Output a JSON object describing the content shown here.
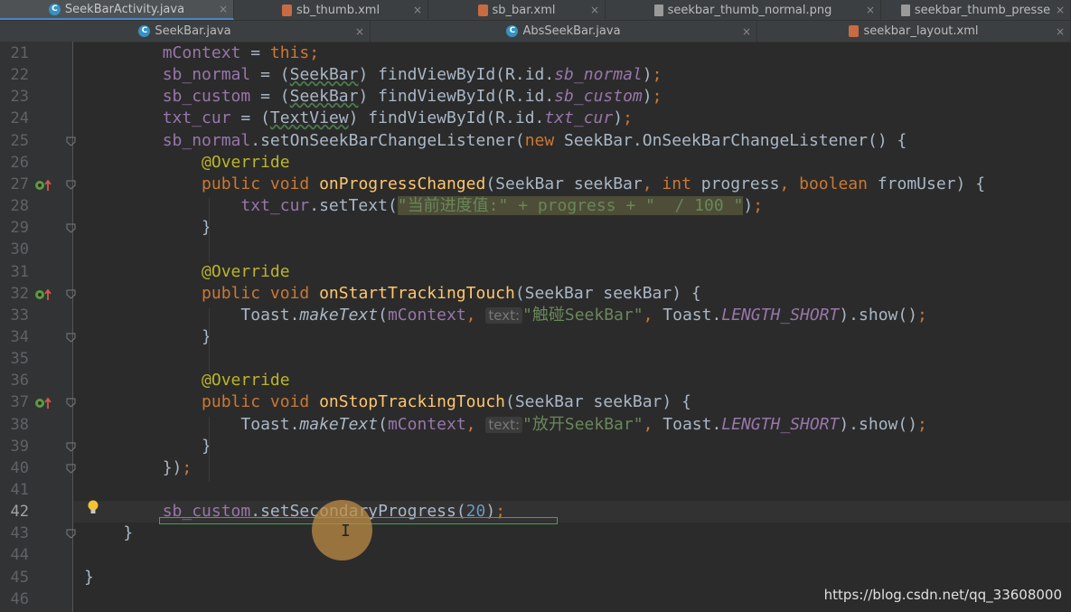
{
  "tabs_row1": [
    {
      "label": "SeekBarActivity.java",
      "icon": "java-class-icon",
      "active": true
    },
    {
      "label": "sb_thumb.xml",
      "icon": "xml-file-icon"
    },
    {
      "label": "sb_bar.xml",
      "icon": "xml-file-icon"
    },
    {
      "label": "seekbar_thumb_normal.png",
      "icon": "image-file-icon"
    },
    {
      "label": "seekbar_thumb_presse",
      "icon": "image-file-icon"
    }
  ],
  "tabs_row2": [
    {
      "label": "SeekBar.java",
      "icon": "java-class-icon"
    },
    {
      "label": "AbsSeekBar.java",
      "icon": "java-class-icon"
    },
    {
      "label": "seekbar_layout.xml",
      "icon": "xml-file-icon"
    }
  ],
  "close_glyph": "×",
  "lines": [
    {
      "n": "21",
      "t": [
        [
          "",
          "        "
        ],
        [
          "fld",
          "mContext"
        ],
        [
          "",
          " = "
        ],
        [
          "kw",
          "this"
        ],
        [
          "kw",
          ";"
        ]
      ]
    },
    {
      "n": "22",
      "t": [
        [
          "",
          "        "
        ],
        [
          "fld",
          "sb_normal"
        ],
        [
          "",
          " = ("
        ],
        [
          "typ",
          "SeekBar"
        ],
        [
          "",
          ") findViewById(R.id."
        ],
        [
          "fldi",
          "sb_normal"
        ],
        [
          "",
          ")"
        ],
        [
          "kw",
          ";"
        ]
      ]
    },
    {
      "n": "23",
      "t": [
        [
          "",
          "        "
        ],
        [
          "fld",
          "sb_custom"
        ],
        [
          "",
          " = ("
        ],
        [
          "typ",
          "SeekBar"
        ],
        [
          "",
          ") findViewById(R.id."
        ],
        [
          "fldi",
          "sb_custom"
        ],
        [
          "",
          ")"
        ],
        [
          "kw",
          ";"
        ]
      ]
    },
    {
      "n": "24",
      "t": [
        [
          "",
          "        "
        ],
        [
          "fld",
          "txt_cur"
        ],
        [
          "",
          " = ("
        ],
        [
          "typ",
          "TextView"
        ],
        [
          "",
          ") findViewById(R.id."
        ],
        [
          "fldi",
          "txt_cur"
        ],
        [
          "",
          ")"
        ],
        [
          "kw",
          ";"
        ]
      ]
    },
    {
      "n": "25",
      "t": [
        [
          "",
          "        "
        ],
        [
          "fld",
          "sb_normal"
        ],
        [
          "",
          ".setOnSeekBarChangeListener("
        ],
        [
          "kw",
          "new "
        ],
        [
          "",
          "SeekBar.OnSeekBarChangeListener() {"
        ]
      ]
    },
    {
      "n": "26",
      "t": [
        [
          "",
          "            "
        ],
        [
          "ann",
          "@Override"
        ]
      ]
    },
    {
      "n": "27",
      "t": [
        [
          "",
          "            "
        ],
        [
          "kw",
          "public void "
        ],
        [
          "mth",
          "onProgressChanged"
        ],
        [
          "",
          "(SeekBar seekBar"
        ],
        [
          "kw",
          ", int "
        ],
        [
          "",
          "progress"
        ],
        [
          "kw",
          ", boolean "
        ],
        [
          "",
          "fromUser) {"
        ]
      ]
    },
    {
      "n": "28",
      "t": [
        [
          "",
          "                "
        ],
        [
          "fld",
          "txt_cur"
        ],
        [
          "",
          ".setText("
        ],
        [
          "hlstr",
          "\"当前进度值:\" + progress + \"  / 100 \""
        ],
        [
          "",
          ")"
        ],
        [
          "kw",
          ";"
        ]
      ]
    },
    {
      "n": "29",
      "t": [
        [
          "",
          "            }"
        ]
      ]
    },
    {
      "n": "30",
      "t": []
    },
    {
      "n": "31",
      "t": [
        [
          "",
          "            "
        ],
        [
          "ann",
          "@Override"
        ]
      ]
    },
    {
      "n": "32",
      "t": [
        [
          "",
          "            "
        ],
        [
          "kw",
          "public void "
        ],
        [
          "mth",
          "onStartTrackingTouch"
        ],
        [
          "",
          "(SeekBar seekBar) {"
        ]
      ]
    },
    {
      "n": "33",
      "t": [
        [
          "",
          "                Toast."
        ],
        [
          "smth",
          "makeText"
        ],
        [
          "",
          "("
        ],
        [
          "fld",
          "mContext"
        ],
        [
          "kw",
          ", "
        ],
        [
          "hint",
          "text:"
        ],
        [
          "str",
          "\"触碰SeekBar\""
        ],
        [
          "kw",
          ", "
        ],
        [
          "",
          "Toast."
        ],
        [
          "fldi",
          "LENGTH_SHORT"
        ],
        [
          "",
          ").show()"
        ],
        [
          "kw",
          ";"
        ]
      ]
    },
    {
      "n": "34",
      "t": [
        [
          "",
          "            }"
        ]
      ]
    },
    {
      "n": "35",
      "t": []
    },
    {
      "n": "36",
      "t": [
        [
          "",
          "            "
        ],
        [
          "ann",
          "@Override"
        ]
      ]
    },
    {
      "n": "37",
      "t": [
        [
          "",
          "            "
        ],
        [
          "kw",
          "public void "
        ],
        [
          "mth",
          "onStopTrackingTouch"
        ],
        [
          "",
          "(SeekBar seekBar) {"
        ]
      ]
    },
    {
      "n": "38",
      "t": [
        [
          "",
          "                Toast."
        ],
        [
          "smth",
          "makeText"
        ],
        [
          "",
          "("
        ],
        [
          "fld",
          "mContext"
        ],
        [
          "kw",
          ", "
        ],
        [
          "hint",
          "text:"
        ],
        [
          "str",
          "\"放开SeekBar\""
        ],
        [
          "kw",
          ", "
        ],
        [
          "",
          "Toast."
        ],
        [
          "fldi",
          "LENGTH_SHORT"
        ],
        [
          "",
          ").show()"
        ],
        [
          "kw",
          ";"
        ]
      ]
    },
    {
      "n": "39",
      "t": [
        [
          "",
          "            }"
        ]
      ]
    },
    {
      "n": "40",
      "t": [
        [
          "",
          "        })"
        ],
        [
          "kw",
          ";"
        ]
      ]
    },
    {
      "n": "41",
      "t": []
    },
    {
      "n": "42",
      "t": [
        [
          "",
          "        "
        ],
        [
          "fld",
          "sb_custom"
        ],
        [
          "",
          ".setSecondaryProgress("
        ],
        [
          "num",
          "20"
        ],
        [
          "",
          ")"
        ],
        [
          "kw",
          ";"
        ]
      ],
      "current": true
    },
    {
      "n": "43",
      "t": [
        [
          "",
          "    }"
        ]
      ]
    },
    {
      "n": "44",
      "t": []
    },
    {
      "n": "45",
      "t": [
        [
          "",
          "}"
        ]
      ]
    },
    {
      "n": "46",
      "t": []
    }
  ],
  "fold_marker_lines": [
    "25",
    "27",
    "29",
    "32",
    "34",
    "37",
    "39",
    "40",
    "43"
  ],
  "override_marker_lines": [
    "27",
    "32",
    "37"
  ],
  "bulb_icon": "lightbulb-icon",
  "watermark": "https://blog.csdn.net/qq_33608000",
  "colors": {
    "background": "#2b2b2b",
    "keyword": "#cc7832",
    "field": "#9876aa",
    "string": "#6a8759",
    "annotation": "#bbb529",
    "method_decl": "#ffc66d",
    "number": "#6897bb"
  }
}
